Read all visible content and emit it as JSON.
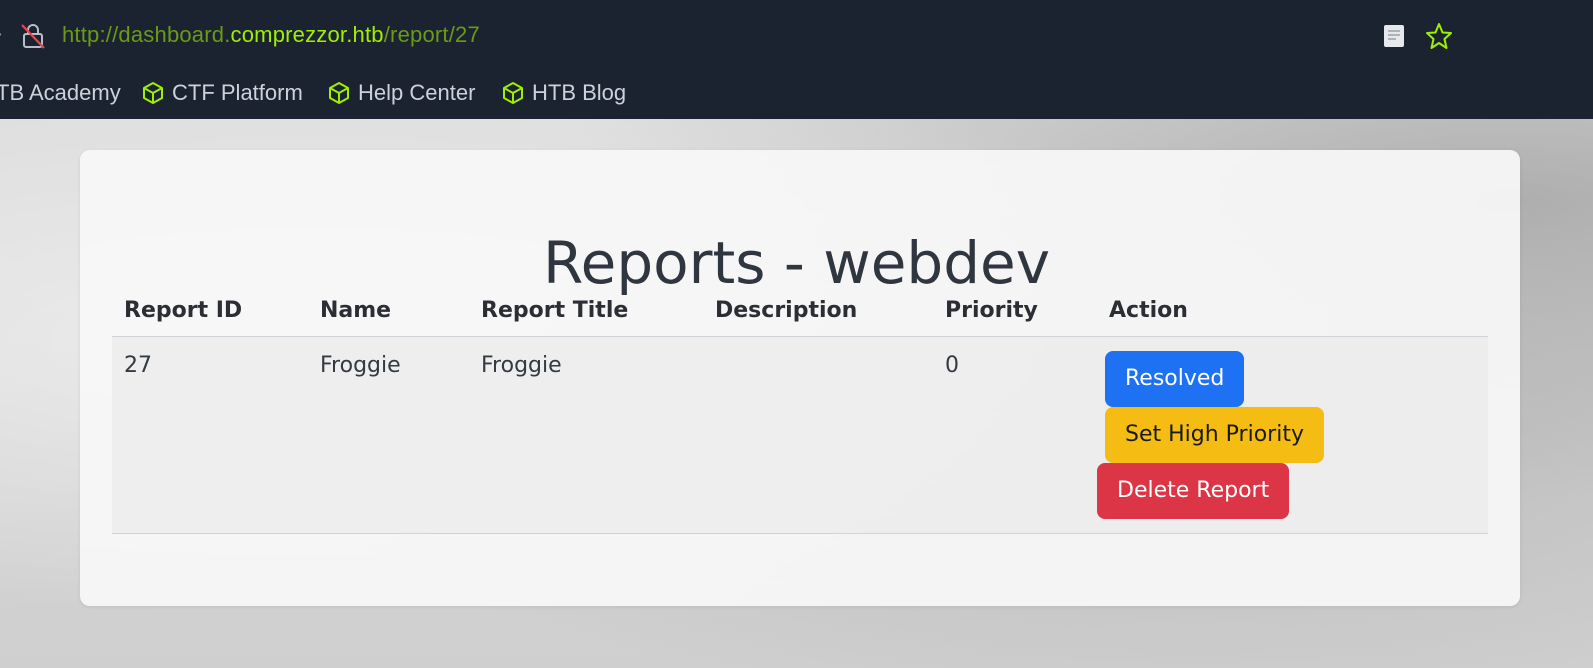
{
  "browser": {
    "url_prefix": "http://dashboard.",
    "url_domain": "comprezzor.htb",
    "url_path": "/report/27",
    "bookmarks": [
      {
        "label": "TB Academy"
      },
      {
        "label": "CTF Platform"
      },
      {
        "label": "Help Center"
      },
      {
        "label": "HTB Blog"
      }
    ]
  },
  "page": {
    "title": "Reports - webdev"
  },
  "table": {
    "headers": [
      "Report ID",
      "Name",
      "Report Title",
      "Description",
      "Priority",
      "Action"
    ],
    "rows": [
      {
        "id": "27",
        "name": "Froggie",
        "title": "Froggie",
        "description": "",
        "priority": "0"
      }
    ]
  },
  "actions": {
    "resolved": "Resolved",
    "high_priority": "Set High Priority",
    "delete": "Delete Report"
  },
  "colors": {
    "chrome_bg": "#1b2331",
    "url_accent": "#9fef00",
    "primary": "#1d71f2",
    "warning": "#f5bd13",
    "danger": "#dc3545"
  }
}
